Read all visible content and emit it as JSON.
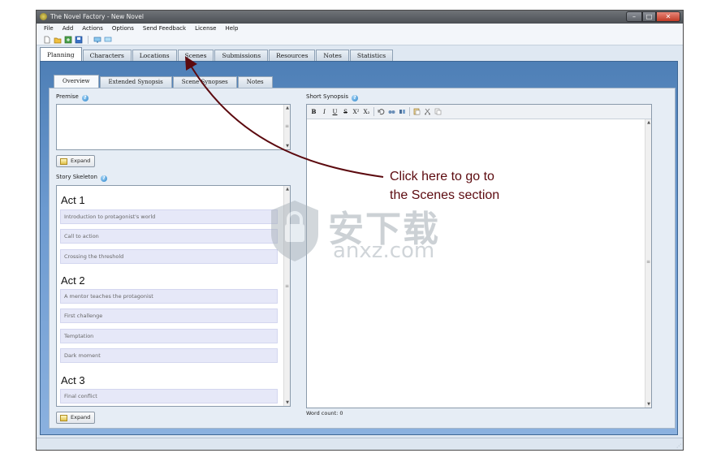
{
  "window": {
    "title": "The Novel Factory - New Novel"
  },
  "menu": [
    "File",
    "Add",
    "Actions",
    "Options",
    "Send Feedback",
    "License",
    "Help"
  ],
  "main_tabs": [
    "Planning",
    "Characters",
    "Locations",
    "Scenes",
    "Submissions",
    "Resources",
    "Notes",
    "Statistics"
  ],
  "sub_tabs": [
    "Overview",
    "Extended Synopsis",
    "Scene Synopses",
    "Notes"
  ],
  "premise": {
    "label": "Premise",
    "expand_label": "Expand"
  },
  "skeleton": {
    "label": "Story Skeleton",
    "expand_label": "Expand",
    "acts": [
      {
        "title": "Act 1",
        "beats": [
          "Introduction to protagonist's world",
          "Call to action",
          "Crossing the threshold"
        ]
      },
      {
        "title": "Act 2",
        "beats": [
          "A mentor teaches the protagonist",
          "First challenge",
          "Temptation",
          "Dark moment"
        ]
      },
      {
        "title": "Act 3",
        "beats": [
          "Final conflict"
        ]
      }
    ]
  },
  "synopsis": {
    "label": "Short Synopsis",
    "format_buttons": [
      "B",
      "I",
      "U",
      "S",
      "X²",
      "X₂"
    ],
    "word_count": "Word count: 0"
  },
  "annotation": {
    "line1": "Click here to go to",
    "line2": "the Scenes section",
    "color": "#5c0a0f"
  },
  "watermark": {
    "cn": "安下载",
    "en": "anxz.com"
  },
  "colors": {
    "accent_blue": "#5a8bc4",
    "panel": "#e6edf5"
  }
}
